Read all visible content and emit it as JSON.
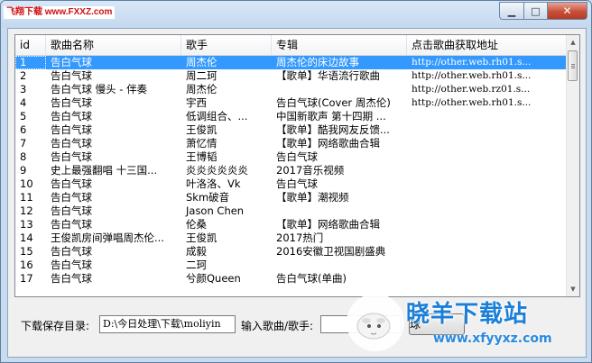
{
  "window": {
    "title": "飞翔下载 www.FXXZ.com",
    "min_glyph": "▁",
    "max_glyph": "□",
    "close_glyph": "✕"
  },
  "table": {
    "columns": [
      "id",
      "歌曲名称",
      "歌手",
      "专辑",
      "点击歌曲获取地址"
    ],
    "rows": [
      [
        "1",
        "告白气球",
        "周杰伦",
        "周杰伦的床边故事",
        "http://other.web.rh01.s..."
      ],
      [
        "2",
        "告白气球",
        "周二珂",
        "【歌单】华语流行歌曲",
        "http://other.web.rh01.s..."
      ],
      [
        "3",
        "告白气球 慢头 - 伴奏",
        "周杰伦",
        "",
        "http://other.web.rz01.s..."
      ],
      [
        "4",
        "告白气球",
        "宇西",
        "告白气球(Cover 周杰伦)",
        "http://other.web.rh01.s..."
      ],
      [
        "5",
        "告白气球",
        "低调组合、...",
        "中国新歌声 第十四期 ...",
        ""
      ],
      [
        "6",
        "告白气球",
        "王俊凯",
        "【歌单】酷我网友反馈...",
        ""
      ],
      [
        "7",
        "告白气球",
        "萧忆情",
        "【歌单】网络歌曲合辑",
        ""
      ],
      [
        "8",
        "告白气球",
        "王博韬",
        "告白气球",
        ""
      ],
      [
        "9",
        "史上最强翻唱 十三国...",
        "炎炎炎炎炎炎",
        "2017音乐视频",
        ""
      ],
      [
        "10",
        "告白气球",
        "叶洛洛、Vk",
        "告白气球",
        ""
      ],
      [
        "11",
        "告白气球",
        "Skm破音",
        "【歌单】潮视频",
        ""
      ],
      [
        "12",
        "告白气球",
        "Jason Chen",
        "",
        ""
      ],
      [
        "13",
        "告白气球",
        "伦桑",
        "【歌单】网络歌曲合辑",
        ""
      ],
      [
        "14",
        "王俊凯房间弹唱周杰伦...",
        "王俊凯",
        "2017热门",
        ""
      ],
      [
        "15",
        "告白气球",
        "成毅",
        "2016安徽卫视国剧盛典",
        ""
      ],
      [
        "16",
        "告白气球",
        "二珂",
        "",
        ""
      ],
      [
        "17",
        "告白气球",
        "兮颜Queen",
        "告白气球(单曲)",
        ""
      ]
    ],
    "selected_index": 0
  },
  "controls": {
    "save_dir_label": "下载保存目录:",
    "save_dir_value": "D:\\今日处理\\下载\\moliyin",
    "search_label": "输入歌曲/歌手:",
    "search_value": "",
    "search_button": "球"
  },
  "watermark": {
    "text": "晓羊下载站",
    "url": "www.xfyyxz.com"
  },
  "scrollbar": {
    "up_glyph": "▲",
    "down_glyph": "▼"
  }
}
